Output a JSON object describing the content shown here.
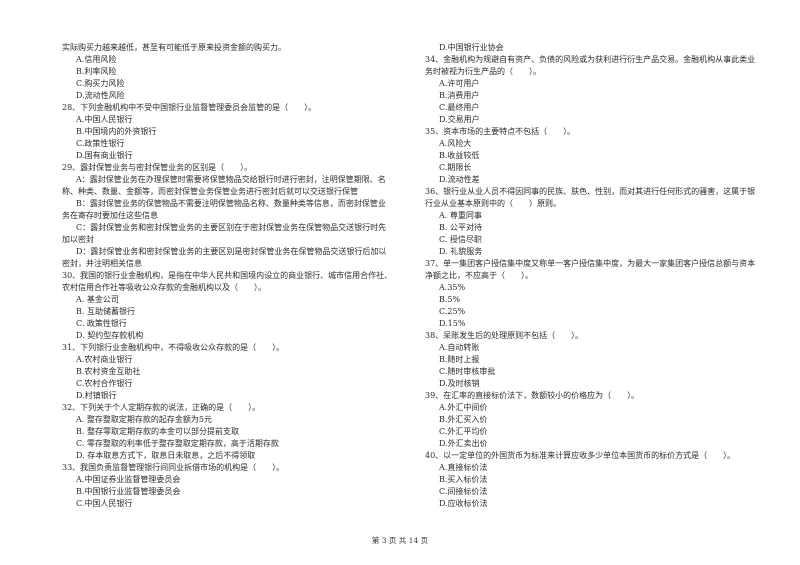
{
  "columns": {
    "left": [
      {
        "t": "实际购买力越来越低，甚至有可能低于原来投资金额的购买力。",
        "k": "q"
      },
      {
        "t": "A.信用风险",
        "k": "opt"
      },
      {
        "t": "B.利率风险",
        "k": "opt"
      },
      {
        "t": "C.购买力风险",
        "k": "opt"
      },
      {
        "t": "D.流动性风险",
        "k": "opt"
      },
      {
        "t": "28、下列金融机构中不受中国银行业监督管理委员会监管的是（　　）。",
        "k": "q"
      },
      {
        "t": "A.中国人民银行",
        "k": "opt"
      },
      {
        "t": "B.中国境内的外资银行",
        "k": "opt"
      },
      {
        "t": "C.政策性银行",
        "k": "opt"
      },
      {
        "t": "D.国有商业银行",
        "k": "opt"
      },
      {
        "t": "29、露封保管业务与密封保管业务的区别是（　　）。",
        "k": "q"
      },
      {
        "t": "A：露封保管业务在办理保管时需要将保管物品交给银行时进行密封，注明保管期限、名",
        "k": "opt"
      },
      {
        "t": "称、种类、数量、金额等，而密封保管业务保管业务进行密封后就可以交送银行保管",
        "k": "q"
      },
      {
        "t": "B：露封保管业务的保管物品不需要注明保管物品名称、数量种类等信息，而密封保管业",
        "k": "opt"
      },
      {
        "t": "务在寄存时要加住这些信息",
        "k": "q"
      },
      {
        "t": "C：露封保管业务和密封保管业务的主要区别在于密封保管业务在保管物品交送银行时先",
        "k": "opt"
      },
      {
        "t": "加以密封",
        "k": "q"
      },
      {
        "t": "D：露封保管业务和密封保管业务的主要区别是密封保管业务在保管物品交送银行后加以",
        "k": "opt"
      },
      {
        "t": "密封，并注明相关信息",
        "k": "q"
      },
      {
        "t": "30、我国的银行业金融机构，是指在中华人民共和国境内设立的商业银行、城市信用合作社、",
        "k": "q"
      },
      {
        "t": "农村信用合作社等吸收公众存款的金融机构以及（　　）。",
        "k": "q"
      },
      {
        "t": "A. 基金公司",
        "k": "opt"
      },
      {
        "t": "B. 互助储蓄银行",
        "k": "opt"
      },
      {
        "t": "C. 政策性银行",
        "k": "opt"
      },
      {
        "t": "D. 契约型存款机构",
        "k": "opt"
      },
      {
        "t": "31、下列银行业金融机构中，不得吸收公众存款的是（　　）。",
        "k": "q"
      },
      {
        "t": "A.农村商业银行",
        "k": "opt"
      },
      {
        "t": "B.农村资金互助社",
        "k": "opt"
      },
      {
        "t": "C.农村合作银行",
        "k": "opt"
      },
      {
        "t": "D.村镇银行",
        "k": "opt"
      },
      {
        "t": "32、下列关于个人定期存款的说法，正确的是（　　）。",
        "k": "q"
      },
      {
        "t": "A. 整存整取定期存款的起存金额为5元",
        "k": "opt"
      },
      {
        "t": "B. 整存零取定期存款的本金可以部分提前支取",
        "k": "opt"
      },
      {
        "t": "C. 零存整取的利率低于整存整取定期存款，高于活期存款",
        "k": "opt"
      },
      {
        "t": "D. 存本取息方式下，取息日未取息，之后不得领取",
        "k": "opt"
      },
      {
        "t": "33、我国负责监督管理银行间同业拆借市场的机构是（　　）。",
        "k": "q"
      },
      {
        "t": "A.中国证券业监督管理委员会",
        "k": "opt"
      },
      {
        "t": "B.中国银行业监督管理委员会",
        "k": "opt"
      },
      {
        "t": "C.中国人民银行",
        "k": "opt"
      }
    ],
    "right": [
      {
        "t": "D.中国银行业协会",
        "k": "opt"
      },
      {
        "t": "34、金融机构为规避自有资产、负债的风险或为获利进行衍生产品交易。金融机构从事此类业",
        "k": "q"
      },
      {
        "t": "务时被视为衍生产品的（　　）。",
        "k": "q"
      },
      {
        "t": "A.许可用户",
        "k": "opt"
      },
      {
        "t": "B.消费用户",
        "k": "opt"
      },
      {
        "t": "C.最终用户",
        "k": "opt"
      },
      {
        "t": "D.交易用户",
        "k": "opt"
      },
      {
        "t": "35、资本市场的主要特点不包括（　　）。",
        "k": "q"
      },
      {
        "t": "A.风险大",
        "k": "opt"
      },
      {
        "t": "B.收益较低",
        "k": "opt"
      },
      {
        "t": "C.期限长",
        "k": "opt"
      },
      {
        "t": "D.流动性差",
        "k": "opt"
      },
      {
        "t": "36、银行业从业人员不得因同事的民族、肤色、性别，而对其进行任何形式的骚害，这属于银",
        "k": "q"
      },
      {
        "t": "行业从业基本原则中的（　　）原则。",
        "k": "q"
      },
      {
        "t": "A. 尊重同事",
        "k": "opt"
      },
      {
        "t": "B. 公平对待",
        "k": "opt"
      },
      {
        "t": "C. 授信尽职",
        "k": "opt"
      },
      {
        "t": "D. 礼貌服务",
        "k": "opt"
      },
      {
        "t": "37、单一集团客户授信集中度又称单一客户授信集中度，为最大一家集团客户授信总额与资本",
        "k": "q"
      },
      {
        "t": "净额之比，不应高于（　　）。",
        "k": "q"
      },
      {
        "t": "A.35%",
        "k": "opt"
      },
      {
        "t": "B.5%",
        "k": "opt"
      },
      {
        "t": "C.25%",
        "k": "opt"
      },
      {
        "t": "D.15%",
        "k": "opt"
      },
      {
        "t": "38、呆账发生后的处理原则不包括（　　）。",
        "k": "q"
      },
      {
        "t": "A.自动转账",
        "k": "opt"
      },
      {
        "t": "B.随时上报",
        "k": "opt"
      },
      {
        "t": "C.随时审核审批",
        "k": "opt"
      },
      {
        "t": "D.及时核销",
        "k": "opt"
      },
      {
        "t": "39、在汇率的直接标价法下，数额较小的价格应为（　　）。",
        "k": "q"
      },
      {
        "t": "A.外汇中间价",
        "k": "opt"
      },
      {
        "t": "B.外汇买入价",
        "k": "opt"
      },
      {
        "t": "C.外汇平均价",
        "k": "opt"
      },
      {
        "t": "D.外汇卖出价",
        "k": "opt"
      },
      {
        "t": "40、以一定单位的外国货币为标准来计算应收多少单位本国货币的标价方式是（　　）。",
        "k": "q"
      },
      {
        "t": "A.直接标价法",
        "k": "opt"
      },
      {
        "t": "B.买入标价法",
        "k": "opt"
      },
      {
        "t": "C.间接标价法",
        "k": "opt"
      },
      {
        "t": "D.应收标价法",
        "k": "opt"
      }
    ]
  },
  "footer": {
    "page_label": "第 3 页 共 14 页"
  }
}
